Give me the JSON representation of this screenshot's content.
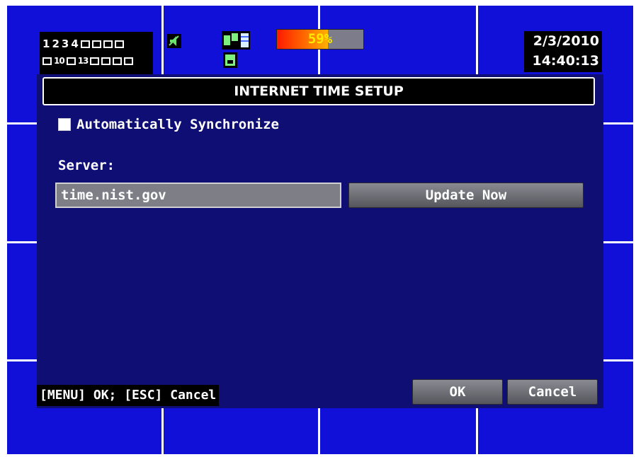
{
  "status_bar": {
    "channels_row1": [
      "1",
      "2",
      "3",
      "4",
      "",
      "",
      "",
      ""
    ],
    "channels_row2": [
      "",
      "10",
      "",
      "13",
      "",
      "",
      "",
      ""
    ],
    "hdd_usage_percent": 59,
    "hdd_usage_label": "59%",
    "date": "2/3/2010",
    "time": "14:40:13",
    "speaker_icon": "speaker-icon",
    "network_icon": "network-icon"
  },
  "dialog": {
    "title": "INTERNET TIME SETUP",
    "auto_sync": {
      "label": "Automatically Synchronize",
      "checked": false
    },
    "server_label": "Server:",
    "server_value": "time.nist.gov",
    "update_button": "Update Now",
    "hint": "[MENU] OK; [ESC] Cancel",
    "ok_button": "OK",
    "cancel_button": "Cancel"
  },
  "colors": {
    "background": "#1010d8",
    "grid_lines": "#ffffff",
    "dialog_bg": "#0e0e74",
    "button_gray": "#7e7e86"
  }
}
